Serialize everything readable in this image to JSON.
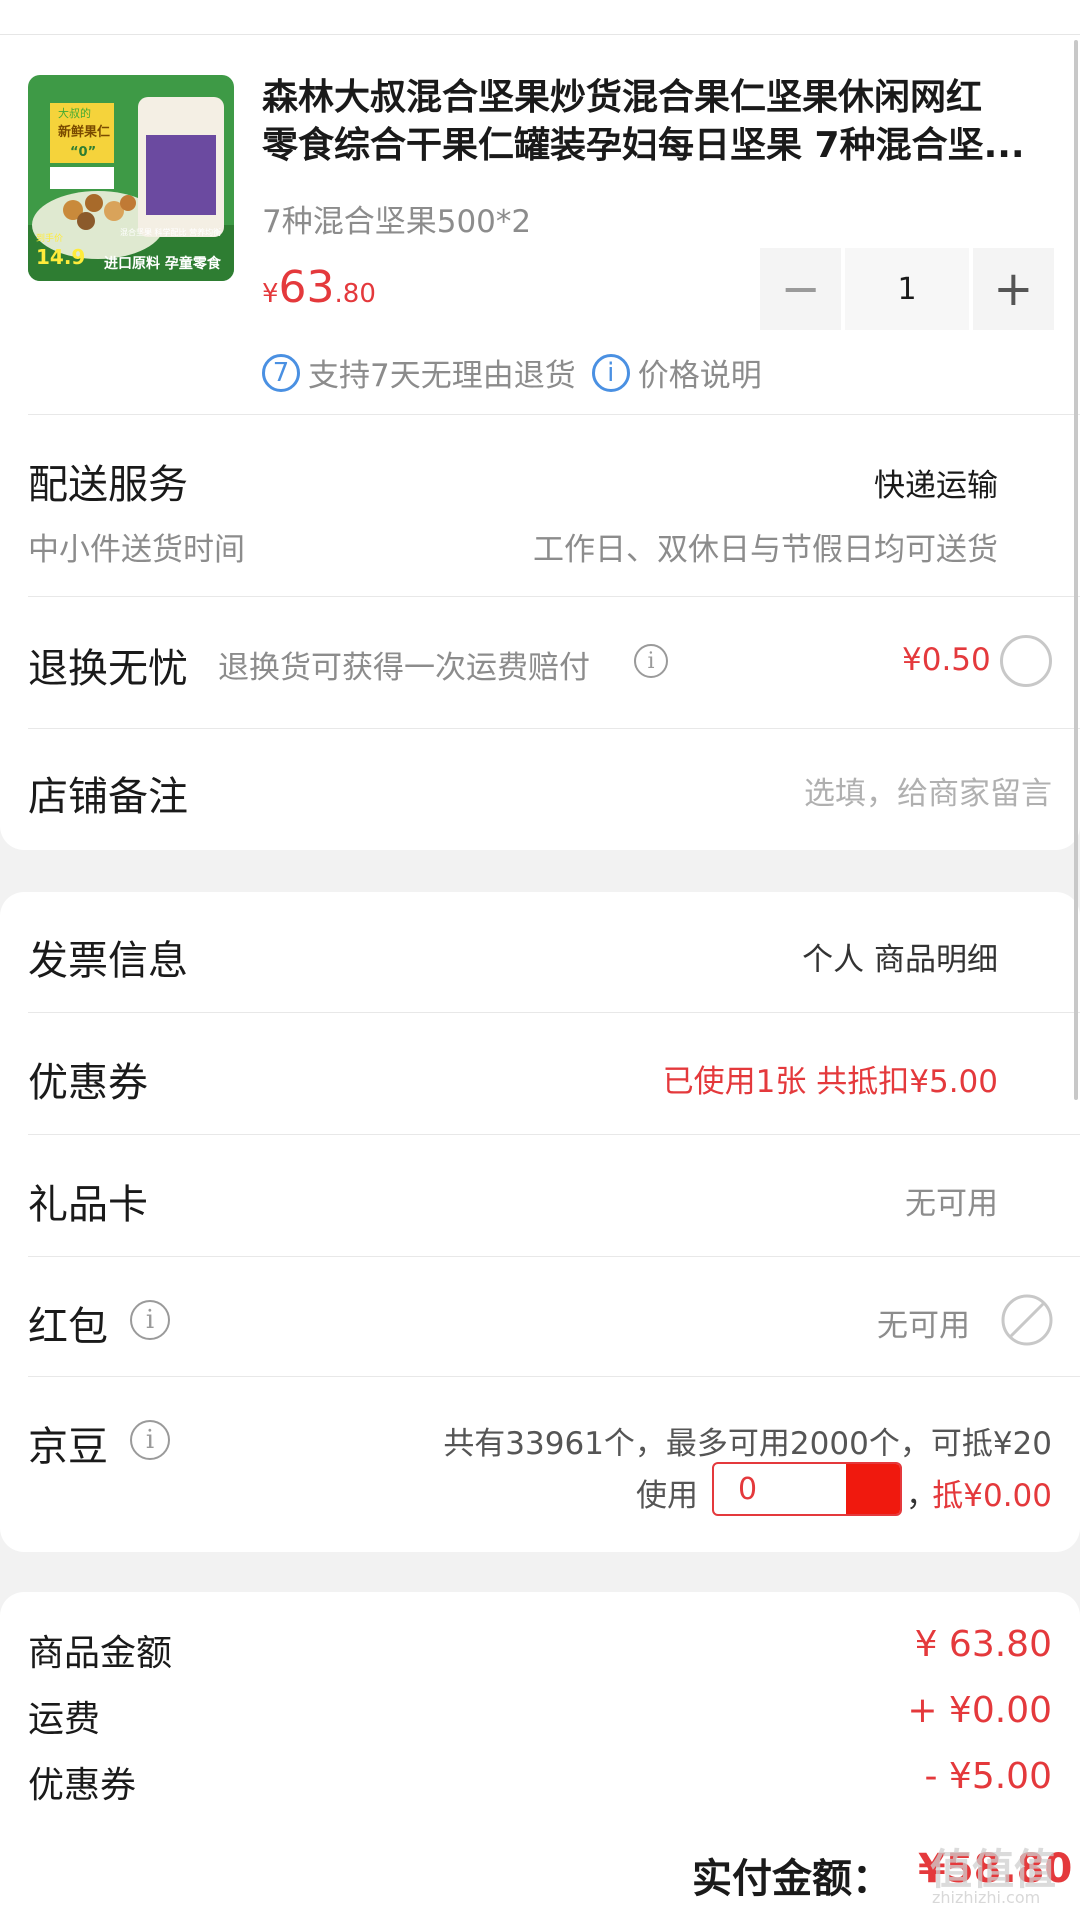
{
  "product": {
    "title_line1": "森林大叔混合坚果炒货混合果仁坚果休闲网红",
    "title_line2": "零食综合干果仁罐装孕妇每日坚果 7种混合坚...",
    "spec": "7种混合坚果500*2",
    "price_symbol": "¥",
    "price_int": "63",
    "price_dec": ".80",
    "quantity": "1",
    "minus_label": "−",
    "plus_label": "+",
    "return_badge": "7",
    "return_text": "支持7天无理由退货",
    "price_note": "价格说明",
    "image": {
      "brand_text": "大叔的",
      "banner": "新鲜果仁",
      "badge": "“0”",
      "price_tag_label": "到手价",
      "price_tag": "14.9",
      "features": "混合坚果 科学配比 营养均衡",
      "bottom_text": "进口原料 孕童零食"
    }
  },
  "delivery": {
    "label": "配送服务",
    "value": "快递运输",
    "sub_label": "中小件送货时间",
    "sub_value": "工作日、双休日与节假日均可送货"
  },
  "return_insurance": {
    "label": "退换无忧",
    "desc": "退换货可获得一次运费赔付",
    "price": "¥0.50"
  },
  "shop_note": {
    "label": "店铺备注",
    "placeholder": "选填，给商家留言"
  },
  "invoice": {
    "label": "发票信息",
    "value": "个人 商品明细"
  },
  "coupon": {
    "label": "优惠券",
    "value": "已使用1张 共抵扣¥5.00"
  },
  "gift_card": {
    "label": "礼品卡",
    "value": "无可用"
  },
  "red_packet": {
    "label": "红包",
    "value": "无可用"
  },
  "jd_beans": {
    "label": "京豆",
    "summary": "共有33961个，最多可用2000个，可抵¥20",
    "use_label": "使用",
    "input_value": "0",
    "comma": "，",
    "deduct": "抵¥0.00"
  },
  "summary": {
    "goods_label": "商品金额",
    "goods_value": "¥ 63.80",
    "shipping_label": "运费",
    "shipping_value": "+ ¥0.00",
    "coupon_label": "优惠券",
    "coupon_value": "- ¥5.00"
  },
  "pay": {
    "label": "实付金额：",
    "value": "¥58.80"
  },
  "watermark": {
    "text": "值值值",
    "sub": "zhizhizhi.com"
  },
  "colors": {
    "accent_red": "#e4393c",
    "link_blue": "#4a90e2",
    "gray_text": "#8c8c8c"
  }
}
